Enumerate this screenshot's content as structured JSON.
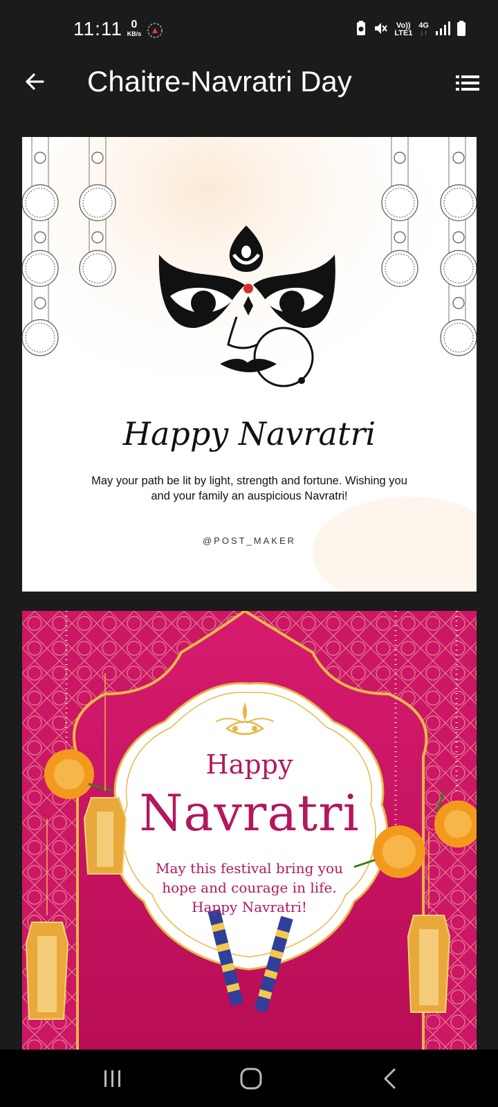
{
  "status_bar": {
    "time": "11:11",
    "net_speed_value": "0",
    "net_speed_unit": "KB/s",
    "volte_label": "Vo))",
    "lte_label": "LTE1",
    "net_type": "4G",
    "icons": [
      "app-notification-icon",
      "battery-saver-icon",
      "mute-icon",
      "signal-icon",
      "battery-icon"
    ]
  },
  "app_bar": {
    "title": "Chaitre-Navratri Day",
    "back_icon": "arrow-left-icon",
    "menu_icon": "list-icon"
  },
  "cards": [
    {
      "heading": "Happy Navratri",
      "message_line1": "May your path be lit by light, strength and fortune. Wishing you",
      "message_line2": "and your family an auspicious Navratri!",
      "handle": "@POST_MAKER",
      "colors": {
        "background": "#ffffff",
        "ink": "#111111",
        "accent": "#d32f2f"
      }
    },
    {
      "happy": "Happy",
      "title": "Navratri",
      "message_line1": "May this festival bring you",
      "message_line2": "hope and courage in life.",
      "message_line3": "Happy Navratri!",
      "colors": {
        "background": "#c5125f",
        "frame": "#ffffff",
        "gold": "#e6b84a",
        "text": "#b3175e",
        "marigold": "#f39a1e"
      }
    }
  ],
  "nav_bar": {
    "icons": [
      "recent-apps-icon",
      "home-icon",
      "back-icon"
    ]
  }
}
